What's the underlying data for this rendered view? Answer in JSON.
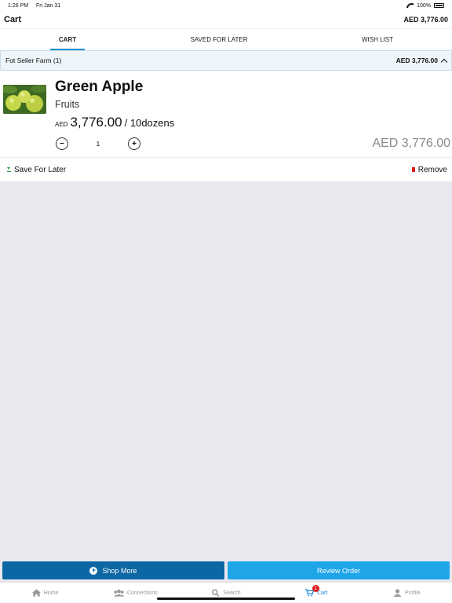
{
  "status_bar": {
    "time": "1:26 PM",
    "date": "Fri Jan 31",
    "battery": "100%"
  },
  "nav": {
    "title": "Cart",
    "total": "AED 3,776.00"
  },
  "tabs": [
    {
      "label": "CART",
      "active": true
    },
    {
      "label": "SAVED FOR LATER",
      "active": false
    },
    {
      "label": "WISH LIST",
      "active": false
    }
  ],
  "seller": {
    "name": "Fot Seller Farm (1)",
    "total": "AED 3,776.00"
  },
  "item": {
    "name": "Green Apple",
    "category": "Fruits",
    "currency": "AED",
    "price": "3,776.00",
    "unit": "/ 10dozens",
    "quantity": "1",
    "line_total": "AED 3,776.00",
    "save_label": "Save For Later",
    "remove_label": "Remove"
  },
  "buttons": {
    "shop_more": "Shop More",
    "review_order": "Review Order"
  },
  "tabbar": {
    "items": [
      {
        "label": "Home",
        "icon": "home-icon"
      },
      {
        "label": "Connections",
        "icon": "connections-icon"
      },
      {
        "label": "Search",
        "icon": "search-icon"
      },
      {
        "label": "Cart",
        "icon": "cart-icon",
        "active": true,
        "badge": "1"
      },
      {
        "label": "Profile",
        "icon": "profile-icon"
      }
    ]
  },
  "colors": {
    "primary": "#1ea6e8",
    "primary_dark": "#0d67a4",
    "remove": "#d81b1b",
    "save": "#2a9a3a",
    "badge": "#e0201f"
  }
}
